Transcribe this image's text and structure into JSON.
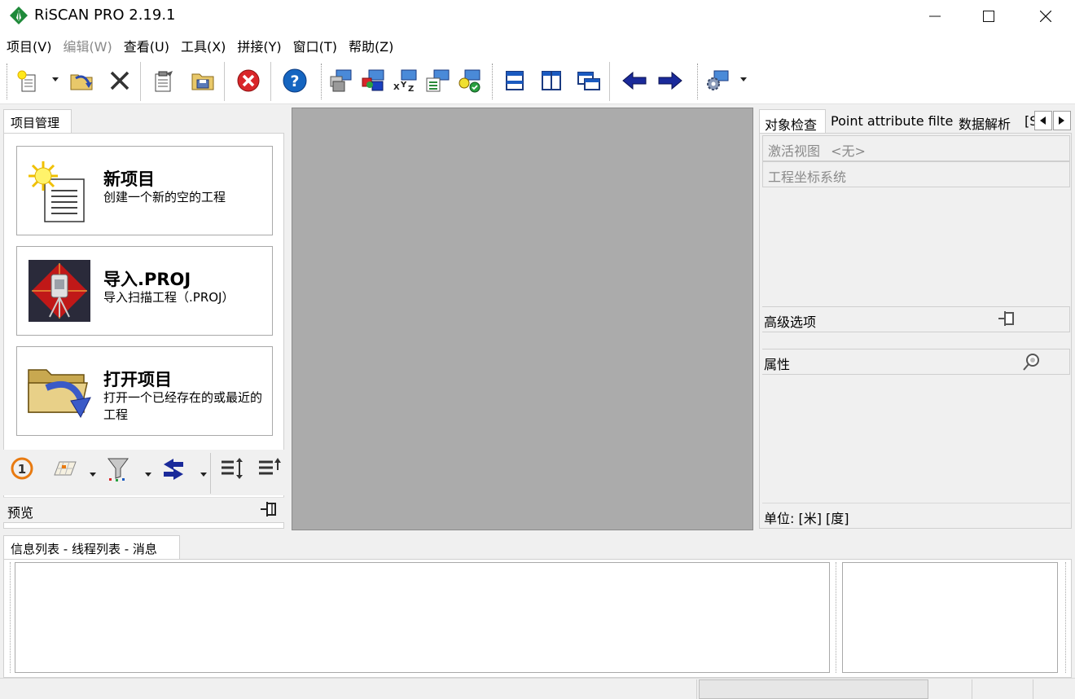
{
  "app": {
    "title": "RiSCAN PRO 2.19.1"
  },
  "window_controls": {
    "minimize": "minimize",
    "maximize": "maximize",
    "close": "close"
  },
  "menu": [
    {
      "label": "项目(V)",
      "enabled": true
    },
    {
      "label": "编辑(W)",
      "enabled": false
    },
    {
      "label": "查看(U)",
      "enabled": true
    },
    {
      "label": "工具(X)",
      "enabled": true
    },
    {
      "label": "拼接(Y)",
      "enabled": true
    },
    {
      "label": "窗口(T)",
      "enabled": true
    },
    {
      "label": "帮助(Z)",
      "enabled": true
    }
  ],
  "toolbar": {
    "icons": [
      "new-project-icon",
      "open-project-icon",
      "close-project-icon",
      "properties-icon",
      "save-icon",
      "stop-icon",
      "help-icon",
      "scan-positions-icon",
      "register-icon",
      "xyz-coordinates-icon",
      "list-view-icon",
      "check-icon",
      "split-horizontal-icon",
      "split-vertical-icon",
      "cascade-windows-icon",
      "back-arrow-icon",
      "forward-arrow-icon",
      "settings-icon"
    ]
  },
  "left_panel": {
    "tab_label": "项目管理",
    "cards": [
      {
        "title": "新项目",
        "desc": "创建一个新的空的工程"
      },
      {
        "title": "导入.PROJ",
        "desc": "导入扫描工程（.PROJ）"
      },
      {
        "title": "打开项目",
        "desc": "打开一个已经存在的或最近的工程"
      }
    ],
    "preview_label": "预览"
  },
  "right_panel": {
    "tabs": [
      "对象检查",
      "Point attribute filter",
      "数据解析",
      "[S"
    ],
    "active_view_label": "激活视图",
    "active_view_value": "<无>",
    "coord_system_label": "工程坐标系统",
    "advanced_label": "高级选项",
    "properties_label": "属性",
    "units_label": "单位: [米] [度]"
  },
  "bottom_panel": {
    "tab_label": "信息列表 - 线程列表 - 消息"
  },
  "colors": {
    "viewport": "#ababab",
    "panel": "#f0f0f0",
    "accent_blue": "#1a73c8",
    "stop_red": "#d9262a"
  }
}
